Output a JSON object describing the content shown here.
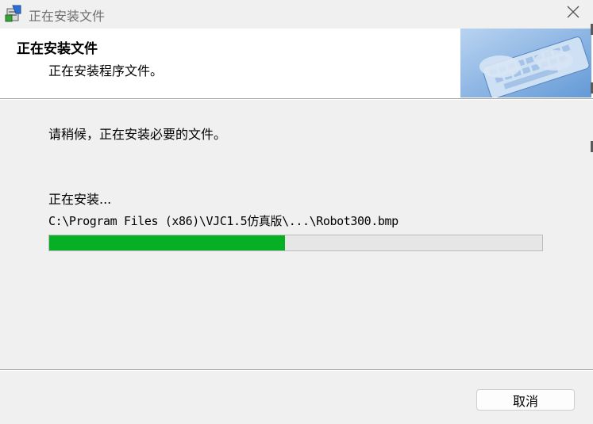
{
  "window": {
    "title": "正在安装文件",
    "icon": "installer-package-icon",
    "close_icon": "close-icon"
  },
  "header": {
    "title": "正在安装文件",
    "subtitle": "正在安装程序文件。",
    "banner": "keyboard-hands-image"
  },
  "body": {
    "message": "请稍候，正在安装必要的文件。",
    "status_label": "正在安装...",
    "current_file": "C:\\Program Files (x86)\\VJC1.5仿真版\\...\\Robot300.bmp",
    "progress_fraction": 0.478,
    "progress_color": "#06b025"
  },
  "footer": {
    "cancel_label": "取消"
  }
}
